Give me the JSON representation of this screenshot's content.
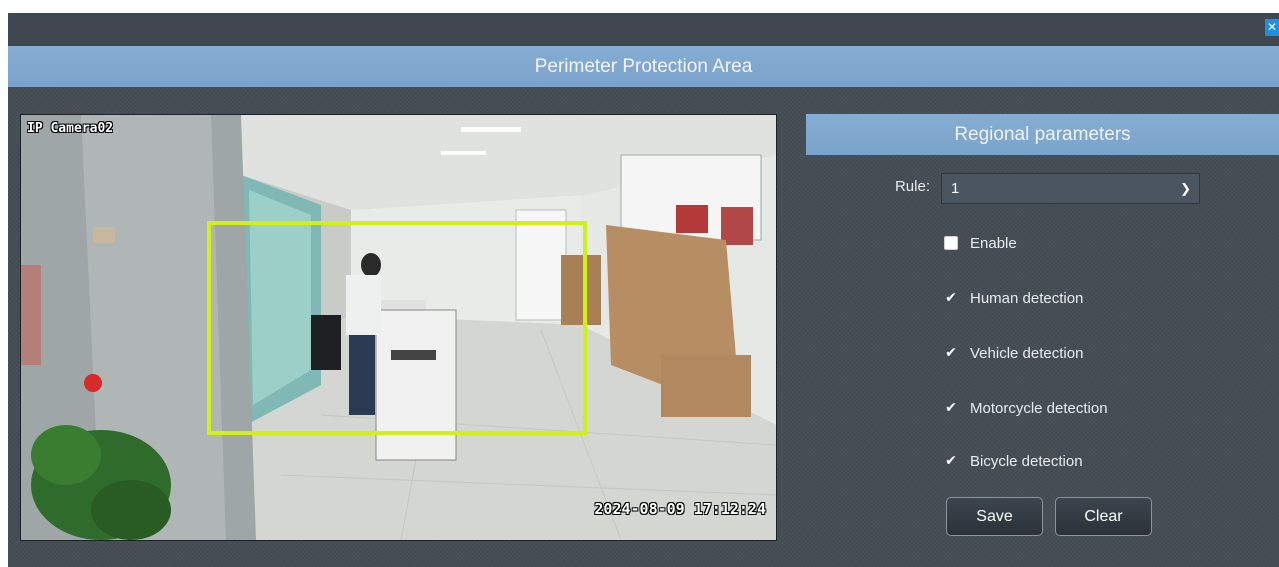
{
  "dialog": {
    "title": "Perimeter Protection Area",
    "close_icon": "close-icon"
  },
  "camera": {
    "label": "IP Camera02",
    "timestamp": "2024-08-09 17:12:24",
    "region_color": "#d2ef19"
  },
  "panel": {
    "title": "Regional parameters",
    "rule_label": "Rule:",
    "rule_value": "1",
    "options": [
      {
        "label": "Enable",
        "checked": false
      },
      {
        "label": "Human detection",
        "checked": true
      },
      {
        "label": "Vehicle detection",
        "checked": true
      },
      {
        "label": "Motorcycle detection",
        "checked": true
      },
      {
        "label": "Bicycle detection",
        "checked": true
      }
    ],
    "save_label": "Save",
    "clear_label": "Clear"
  }
}
